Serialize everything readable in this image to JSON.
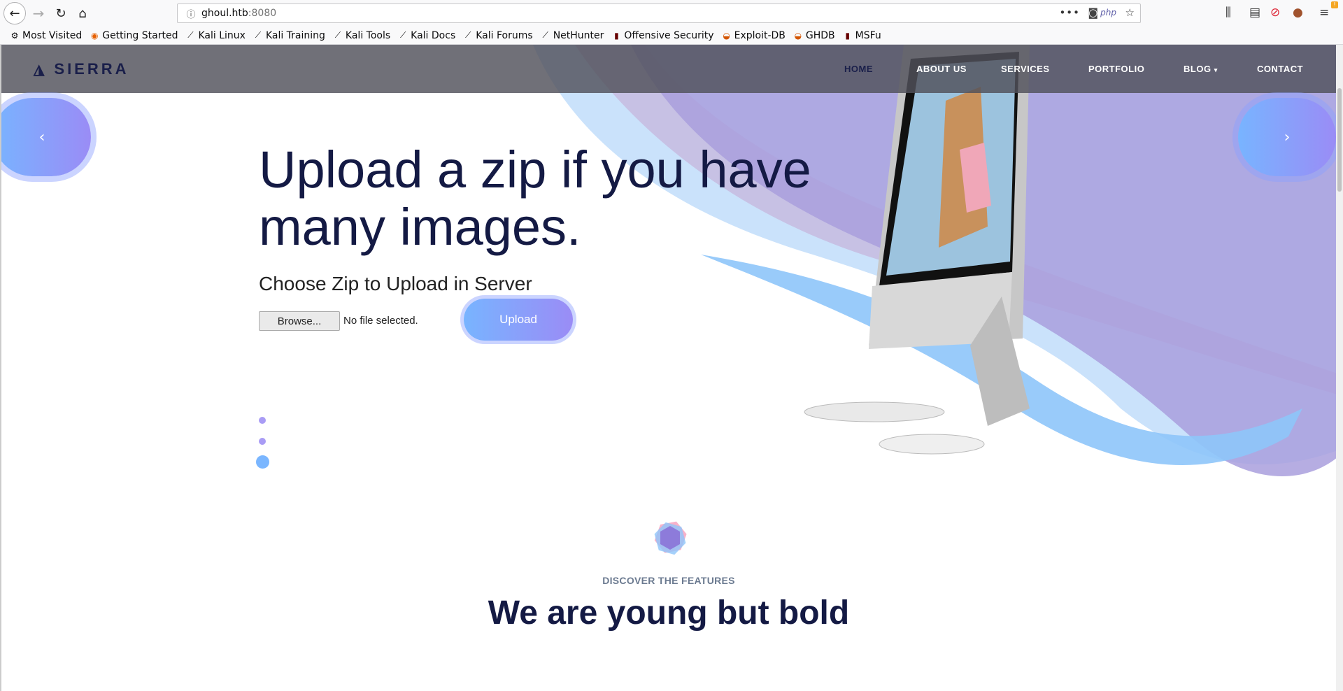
{
  "browser": {
    "url_host": "ghoul.htb",
    "url_port": ":8080",
    "url_php_badge": "php",
    "bookmarks": [
      {
        "label": "Most Visited",
        "icon": "gear-icon"
      },
      {
        "label": "Getting Started",
        "icon": "firefox-icon"
      },
      {
        "label": "Kali Linux",
        "icon": "kali-dragon-icon"
      },
      {
        "label": "Kali Training",
        "icon": "kali-dragon-icon"
      },
      {
        "label": "Kali Tools",
        "icon": "kali-dragon-icon"
      },
      {
        "label": "Kali Docs",
        "icon": "kali-dragon-icon"
      },
      {
        "label": "Kali Forums",
        "icon": "kali-dragon-icon"
      },
      {
        "label": "NetHunter",
        "icon": "kali-dragon-icon"
      },
      {
        "label": "Offensive Security",
        "icon": "offsec-icon"
      },
      {
        "label": "Exploit-DB",
        "icon": "exploitdb-icon"
      },
      {
        "label": "GHDB",
        "icon": "exploitdb-icon"
      },
      {
        "label": "MSFu",
        "icon": "offsec-icon"
      }
    ]
  },
  "site": {
    "logo_text": "SIERRA",
    "nav": {
      "home": "HOME",
      "about": "ABOUT US",
      "services": "SERVICES",
      "portfolio": "PORTFOLIO",
      "blog": "BLOG",
      "contact": "CONTACT"
    },
    "hero": {
      "headline": "Upload a zip if you have many images.",
      "subtitle": "Choose Zip to Upload in Server",
      "browse_label": "Browse...",
      "file_status": "No file selected.",
      "upload_label": "Upload",
      "prev_arrow": "‹",
      "next_arrow": "›"
    },
    "features": {
      "label": "DISCOVER THE FEATURES",
      "title": "We are young but bold"
    }
  },
  "colors": {
    "accent_blue": "#78b4ff",
    "accent_purple": "#9a8cf6",
    "heading": "#141a44"
  }
}
